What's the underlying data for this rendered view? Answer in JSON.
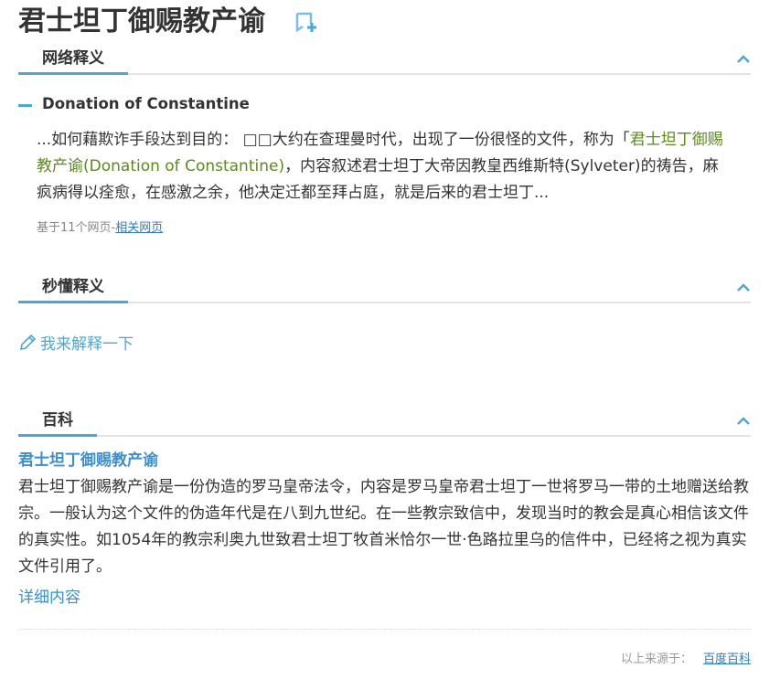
{
  "title": "君士坦丁御赐教产谕",
  "icons": {
    "bookmark": "bookmark-add-icon",
    "collapse": "chevron-up-icon",
    "pencil": "pencil-icon"
  },
  "colors": {
    "accent": "#4aa8d8",
    "link": "#3a8fd0",
    "highlight": "#5b8a1f"
  },
  "web_definition": {
    "section_title": "网络释义",
    "entry_title": "Donation of Constantine",
    "text_before": "...如何藉欺诈手段达到目的：  □□大约在查理曼时代，出现了一份很怪的文件，称为「",
    "text_highlight": "君士坦丁御赐教产谕(Donation of Constantine)",
    "text_after": "，内容叙述君士坦丁大帝因教皇西维斯特(Sylveter)的祷告，麻疯病得以痊愈，在感激之余，他决定迁都至拜占庭，就是后来的君士坦丁...",
    "source_prefix": "基于11个网页-",
    "source_link": "相关网页"
  },
  "quick_definition": {
    "section_title": "秒懂释义",
    "explain_label": "我来解释一下"
  },
  "baike": {
    "section_title": "百科",
    "entry_title": "君士坦丁御赐教产谕",
    "text": "君士坦丁御赐教产谕是一份伪造的罗马皇帝法令，内容是罗马皇帝君士坦丁一世将罗马一带的土地赠送给教宗。一般认为这个文件的伪造年代是在八到九世纪。在一些教宗致信中，发现当时的教会是真心相信该文件的真实性。如1054年的教宗利奥九世致君士坦丁牧首米恰尔一世·色路拉里乌的信件中，已经将之视为真实文件引用了。",
    "more_link": "详细内容",
    "footer_prefix": "以上来源于：",
    "footer_link": "百度百科"
  }
}
